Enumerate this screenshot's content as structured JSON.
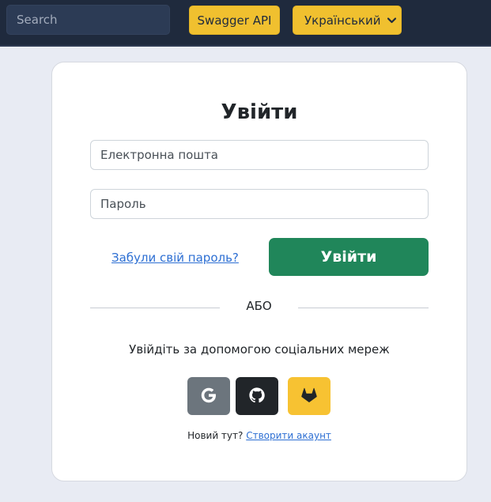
{
  "navbar": {
    "search_placeholder": "Search",
    "swagger_label": "Swagger API",
    "language_selected": "Український"
  },
  "login": {
    "title": "Увійти",
    "email_placeholder": "Електронна пошта",
    "password_placeholder": "Пароль",
    "forgot_password": "Забули свій пароль?",
    "submit_label": "Увійти",
    "divider_text": "АБО",
    "social_prompt": "Увійдіть за допомогою соціальних мереж",
    "social_buttons": [
      {
        "name": "google",
        "icon": "google-icon",
        "color": "#6c757d"
      },
      {
        "name": "github",
        "icon": "github-icon",
        "color": "#212529"
      },
      {
        "name": "gitlab",
        "icon": "gitlab-icon",
        "color": "#f7c232"
      }
    ],
    "new_here": "Новий тут?",
    "create_account": "Створити акаунт"
  },
  "colors": {
    "navbar_bg": "#1f2a3d",
    "accent_yellow": "#f0c02f",
    "primary_green": "#20865a",
    "link_blue": "#2d6fd3"
  }
}
